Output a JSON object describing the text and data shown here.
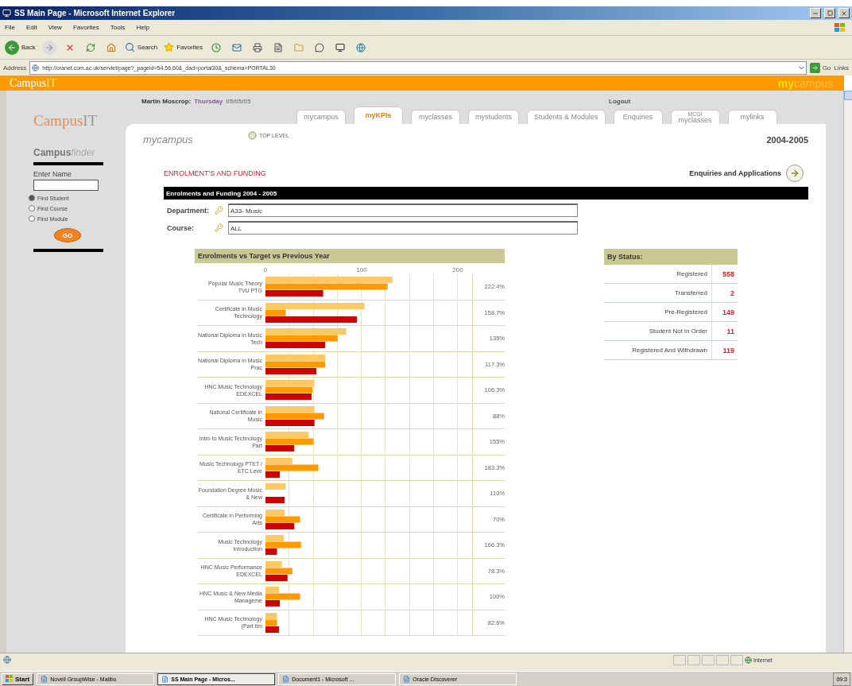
{
  "window": {
    "title": "SS Main Page - Microsoft Internet Explorer"
  },
  "menu": [
    "File",
    "Edit",
    "View",
    "Favorites",
    "Tools",
    "Help"
  ],
  "toolbar": {
    "back": "Back",
    "search": "Search",
    "favorites": "Favorites"
  },
  "address_bar": {
    "label": "Address",
    "url": "http://oranet.com.ac.uk/servlet/page?_pageid=54,56,60&_dad=portal30&_schema=PORTAL30",
    "go": "Go",
    "links": "Links"
  },
  "banner": {
    "logo": [
      "Campus",
      "IT"
    ],
    "brand": [
      "my",
      "campus"
    ]
  },
  "user_line": {
    "name": "Martin Moscrop:",
    "day": "Thursday",
    "date": "05/05/05",
    "logout": "Logout"
  },
  "sidebar": {
    "logo": [
      "Campus",
      "IT"
    ],
    "finder": [
      "Campus",
      "finder"
    ],
    "field_label": "Enter Name",
    "options": [
      {
        "label": "Find Student",
        "selected": true
      },
      {
        "label": "Find Course",
        "selected": false
      },
      {
        "label": "Find Module",
        "selected": false
      }
    ],
    "button": "GO"
  },
  "tabs": [
    {
      "label": "mycampus",
      "selected": false
    },
    {
      "label": "myKPIs",
      "selected": true
    },
    {
      "label": "myclasses",
      "selected": false
    },
    {
      "label": "mystudents",
      "selected": false
    },
    {
      "label": "Students & Modules",
      "selected": false
    },
    {
      "label": "Enquiries",
      "selected": false
    },
    {
      "label": "myclasses",
      "note": "MCGI",
      "selected": false
    },
    {
      "label": "mylinks",
      "selected": false
    }
  ],
  "content": {
    "section": "mycampus",
    "top_level": "TOP LEVEL",
    "year": "2004-2005",
    "heading": "ENROLMENT'S AND FUNDING",
    "link": "Enquiries and Applications",
    "bar_title": "Enrolments and Funding 2004 - 2005",
    "filters": [
      {
        "label": "Department:",
        "value": "A33- Music"
      },
      {
        "label": "Course:",
        "value": "ALL"
      }
    ]
  },
  "chart": {
    "chart_data": {
      "type": "bar",
      "orientation": "horizontal",
      "title": "Enrolments vs Target vs Previous Year",
      "xlim": [
        0,
        215
      ],
      "xticks": [
        0,
        100,
        200
      ],
      "categories": [
        "Popular Music Theory TVU PTG",
        "Certificate in Music Technology",
        "National Diploma in Music Tech",
        "National Diploma in Music Prac",
        "HNC Music Technology EDEXCEL",
        "National Certificate in Music",
        "Intro to Music Technology Part",
        "Music Technology PTET / ETC Leve",
        "Foundation Degree Music & New",
        "Certificate in Performing Arts",
        "Music Technology Introduction",
        "HNC Music Performance EDEXCEL",
        "HNC Music & New Media Manageme",
        "HNC Music Technology (Part tim"
      ],
      "series": [
        {
          "color": "#fdc866",
          "values": [
            132,
            103,
            84,
            62,
            51,
            51,
            45,
            28,
            21,
            20,
            19,
            17,
            14,
            12
          ]
        },
        {
          "color": "#ff9900",
          "values": [
            127,
            21,
            75,
            62,
            49,
            61,
            50,
            55,
            null,
            36,
            37,
            28,
            36,
            12
          ]
        },
        {
          "color": "#cc0000",
          "values": [
            60,
            95,
            62,
            53,
            48,
            51,
            30,
            15,
            20,
            30,
            12,
            23,
            15,
            14
          ]
        }
      ],
      "annotations": [
        "222.4%",
        "158.7%",
        "135%",
        "117.3%",
        "106.3%",
        "88%",
        "155%",
        "183.3%",
        "110%",
        "70%",
        "166.3%",
        "78.3%",
        "100%",
        "82.6%"
      ]
    }
  },
  "by_status": {
    "title": "By Status:",
    "rows": [
      {
        "label": "Registered",
        "value": "558"
      },
      {
        "label": "Transferred",
        "value": "2"
      },
      {
        "label": "Pre-Registered",
        "value": "149"
      },
      {
        "label": "Student Not in Order",
        "value": "11"
      },
      {
        "label": "Registered And Withdrawn",
        "value": "119"
      }
    ]
  },
  "status_bar": {
    "zone": "Internet"
  },
  "taskbar": {
    "start": "Start",
    "items": [
      {
        "label": "Novell GroupWise - Mailbo",
        "selected": false
      },
      {
        "label": "SS Main Page - Micros...",
        "selected": true
      },
      {
        "label": "Document1 - Microsoft ...",
        "selected": false
      },
      {
        "label": "Oracle Discoverer",
        "selected": false
      }
    ],
    "clock": "09:3"
  }
}
